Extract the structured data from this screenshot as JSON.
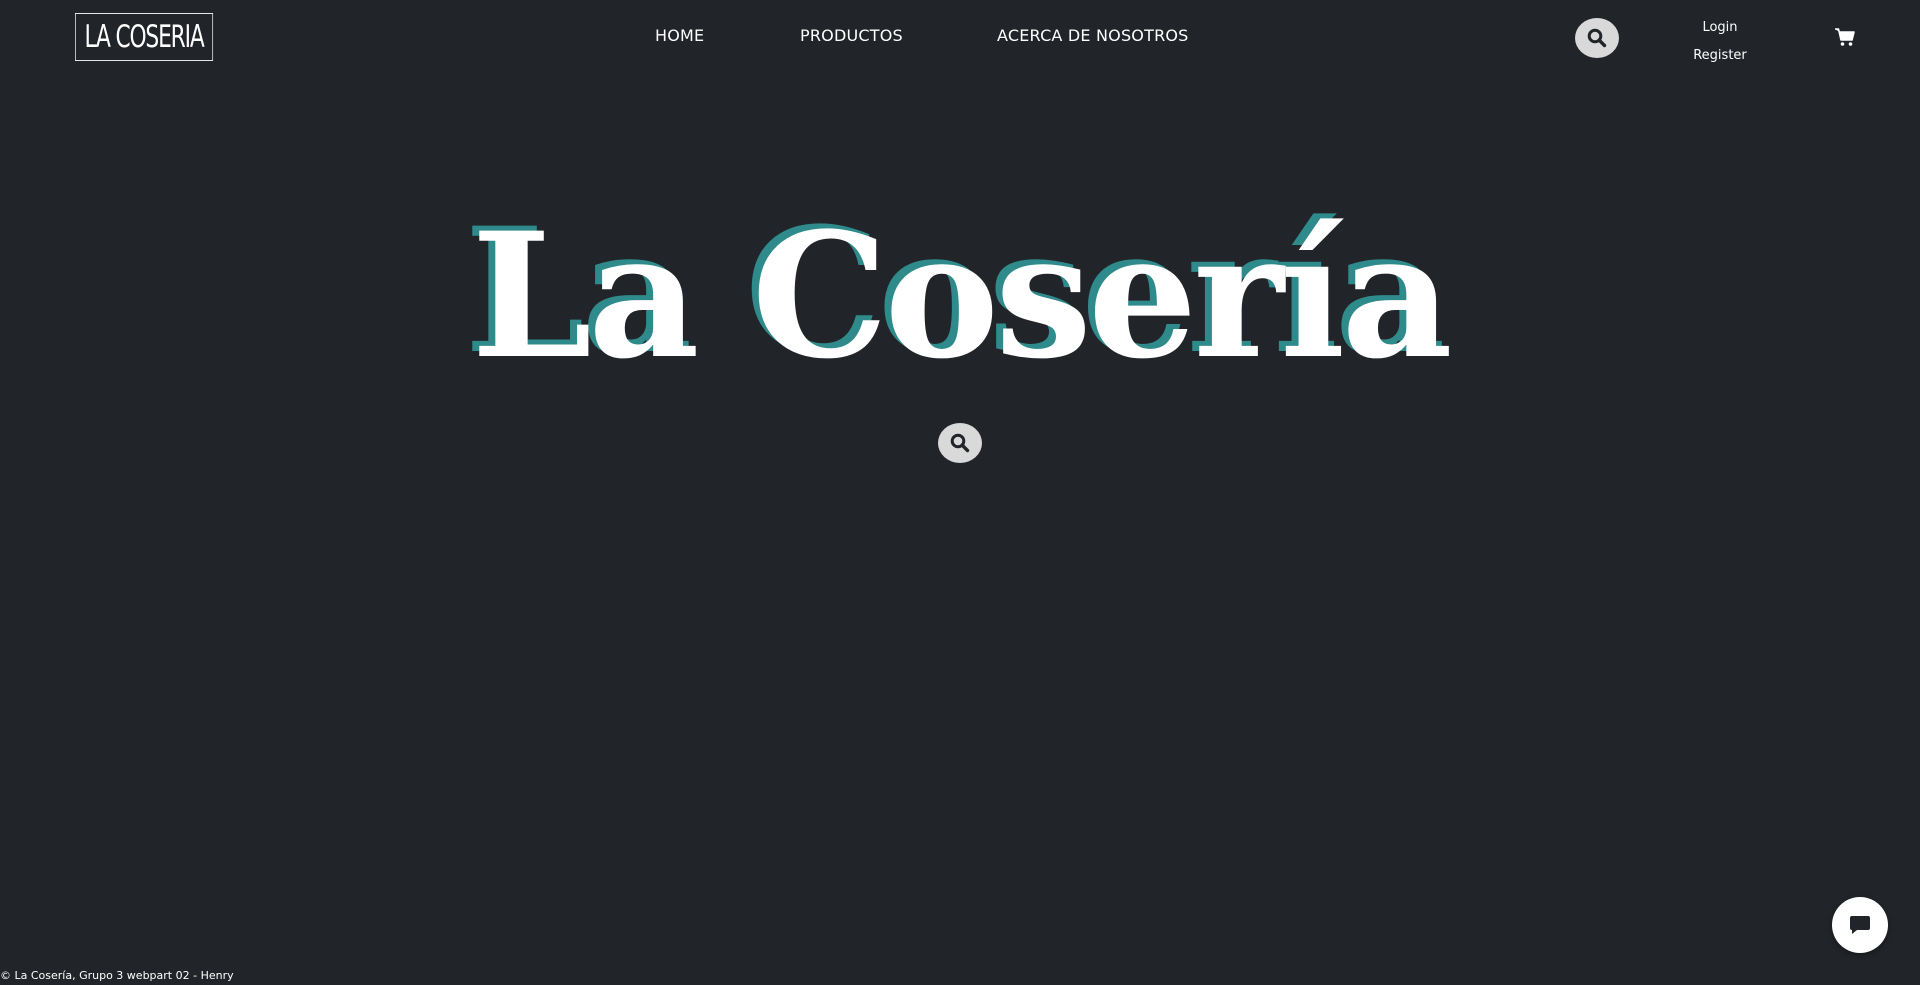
{
  "header": {
    "logo_text": "LA COSERIA",
    "nav": {
      "home": "HOME",
      "productos": "PRODUCTOS",
      "about": "ACERCA DE NOSOTROS"
    },
    "search_icon": "search-icon",
    "auth": {
      "login": "Login",
      "register": "Register"
    },
    "cart_icon": "shopping-cart-icon"
  },
  "hero": {
    "title": "La Cosería",
    "search_icon": "search-icon"
  },
  "footer": {
    "copyright": "© La Cosería, Grupo 3 webpart 02 - Henry"
  },
  "chat": {
    "icon": "chat-bubble-icon"
  },
  "colors": {
    "background": "#212429",
    "accent_shadow": "#2f8b8b",
    "search_button": "#d9d9d9"
  }
}
